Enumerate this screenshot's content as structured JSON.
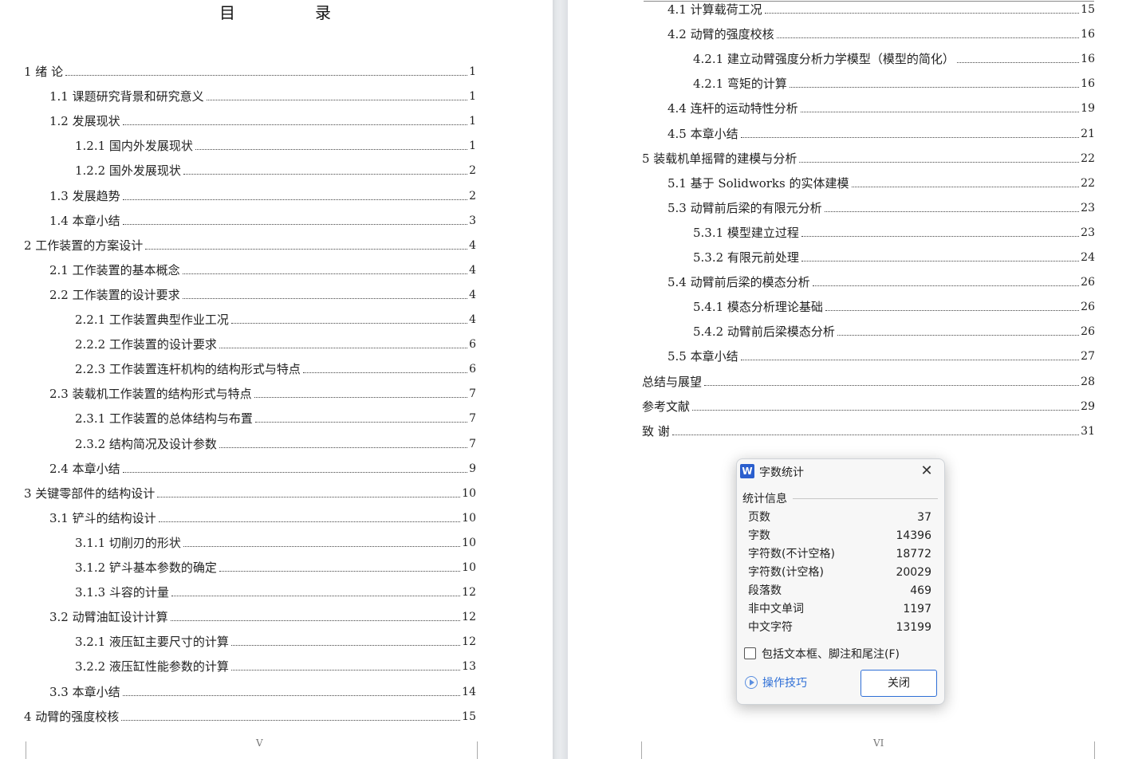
{
  "left_page": {
    "title": "目　录",
    "page_footer": "V",
    "entries": [
      {
        "text": "1 绪  论",
        "page": "1"
      },
      {
        "text": "1.1 课题研究背景和研究意义",
        "page": "1"
      },
      {
        "text": "1.2 发展现状",
        "page": "1"
      },
      {
        "text": "1.2.1 国内外发展现状",
        "page": "1"
      },
      {
        "text": "1.2.2 国外发展现状",
        "page": "2"
      },
      {
        "text": "1.3 发展趋势",
        "page": "2"
      },
      {
        "text": "1.4 本章小结",
        "page": "3"
      },
      {
        "text": "2  工作装置的方案设计",
        "page": "4"
      },
      {
        "text": "2.1 工作装置的基本概念",
        "page": "4"
      },
      {
        "text": "2.2 工作装置的设计要求",
        "page": "4"
      },
      {
        "text": "2.2.1 工作装置典型作业工况",
        "page": "4"
      },
      {
        "text": "2.2.2 工作装置的设计要求",
        "page": "6"
      },
      {
        "text": "2.2.3 工作装置连杆机构的结构形式与特点",
        "page": "6"
      },
      {
        "text": "2.3 装载机工作装置的结构形式与特点",
        "page": "7"
      },
      {
        "text": "2.3.1 工作装置的总体结构与布置",
        "page": "7"
      },
      {
        "text": "2.3.2  结构简况及设计参数",
        "page": "7"
      },
      {
        "text": "2.4  本章小结",
        "page": "9"
      },
      {
        "text": "3  关键零部件的结构设计",
        "page": "10"
      },
      {
        "text": "3.1 铲斗的结构设计",
        "page": "10"
      },
      {
        "text": "3.1.1 切削刃的形状",
        "page": "10"
      },
      {
        "text": "3.1.2  铲斗基本参数的确定",
        "page": "10"
      },
      {
        "text": "3.1.3 斗容的计量",
        "page": "12"
      },
      {
        "text": "3.2 动臂油缸设计计算",
        "page": "12"
      },
      {
        "text": "3.2.1 液压缸主要尺寸的计算",
        "page": "12"
      },
      {
        "text": "3.2.2 液压缸性能参数的计算",
        "page": "13"
      },
      {
        "text": "3.3 本章小结",
        "page": "14"
      },
      {
        "text": "4  动臂的强度校核",
        "page": "15"
      }
    ]
  },
  "right_page": {
    "page_footer": "VI",
    "entries": [
      {
        "text": "4.1  计算载荷工况",
        "page": "15"
      },
      {
        "text": "4.2  动臂的强度校核",
        "page": "16"
      },
      {
        "text": "4.2.1  建立动臂强度分析力学模型（模型的简化）",
        "page": "16"
      },
      {
        "text": "4.2.1 弯矩的计算",
        "page": "16"
      },
      {
        "text": "4.4  连杆的运动特性分析",
        "page": "19"
      },
      {
        "text": "4.5 本章小结",
        "page": "21"
      },
      {
        "text": "5  装载机单摇臂的建模与分析",
        "page": "22"
      },
      {
        "text": "5.1  基于 Solidworks 的实体建模",
        "page": "22"
      },
      {
        "text": "5.3 动臂前后梁的有限元分析",
        "page": "23"
      },
      {
        "text": "5.3.1 模型建立过程",
        "page": "23"
      },
      {
        "text": "5.3.2 有限元前处理",
        "page": "24"
      },
      {
        "text": "5.4 动臂前后梁的模态分析",
        "page": "26"
      },
      {
        "text": "5.4.1 模态分析理论基础",
        "page": "26"
      },
      {
        "text": "5.4.2 动臂前后梁模态分析",
        "page": "26"
      },
      {
        "text": "5.5 本章小结",
        "page": "27"
      },
      {
        "text": "总结与展望",
        "page": "28"
      },
      {
        "text": "参考文献",
        "page": "29"
      },
      {
        "text": "致  谢",
        "page": "31"
      }
    ]
  },
  "dialog": {
    "logo": "W",
    "title": "字数统计",
    "close_glyph": "✕",
    "group_label": "统计信息",
    "stats": [
      {
        "label": "页数",
        "value": "37"
      },
      {
        "label": "字数",
        "value": "14396"
      },
      {
        "label": "字符数(不计空格)",
        "value": "18772"
      },
      {
        "label": "字符数(计空格)",
        "value": "20029"
      },
      {
        "label": "段落数",
        "value": "469"
      },
      {
        "label": "非中文单词",
        "value": "1197"
      },
      {
        "label": "中文字符",
        "value": "13199"
      }
    ],
    "checkbox_label": "包括文本框、脚注和尾注(F)",
    "checkbox_checked": false,
    "tips_label": "操作技巧",
    "close_button": "关闭"
  }
}
